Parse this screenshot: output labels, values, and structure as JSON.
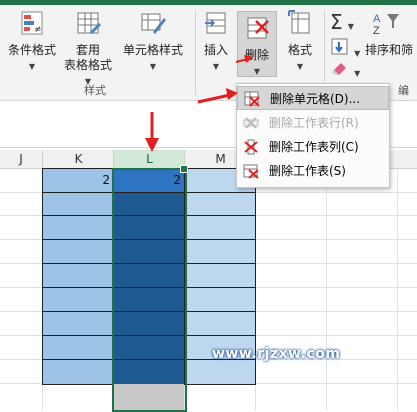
{
  "ribbon": {
    "conditional_format": "条件格式",
    "table_format_line1": "套用",
    "table_format_line2": "表格格式",
    "cell_style": "单元格样式",
    "styles_group": "样式",
    "insert": "插入",
    "delete": "删除",
    "format": "格式",
    "sort_filter": "排序和筛",
    "edit_group": "编辑"
  },
  "delete_menu": {
    "items": [
      {
        "label": "删除单元格(D)...",
        "state": "hover"
      },
      {
        "label": "删除工作表行(R)",
        "state": "disabled"
      },
      {
        "label": "删除工作表列(C)",
        "state": "enabled"
      },
      {
        "label": "删除工作表(S)",
        "state": "enabled"
      }
    ]
  },
  "sheet": {
    "columns": [
      "J",
      "K",
      "L",
      "M"
    ],
    "selected_column": "L",
    "cell_k_value": "2",
    "cell_l_value": "2"
  },
  "watermark": "www.rjzxw.com",
  "colors": {
    "excel_green": "#217346",
    "light_blue": "#9dc3e6",
    "dark_blue": "#1f5a93",
    "pale_blue": "#bdd7ee",
    "arrow_red": "#e02020"
  }
}
